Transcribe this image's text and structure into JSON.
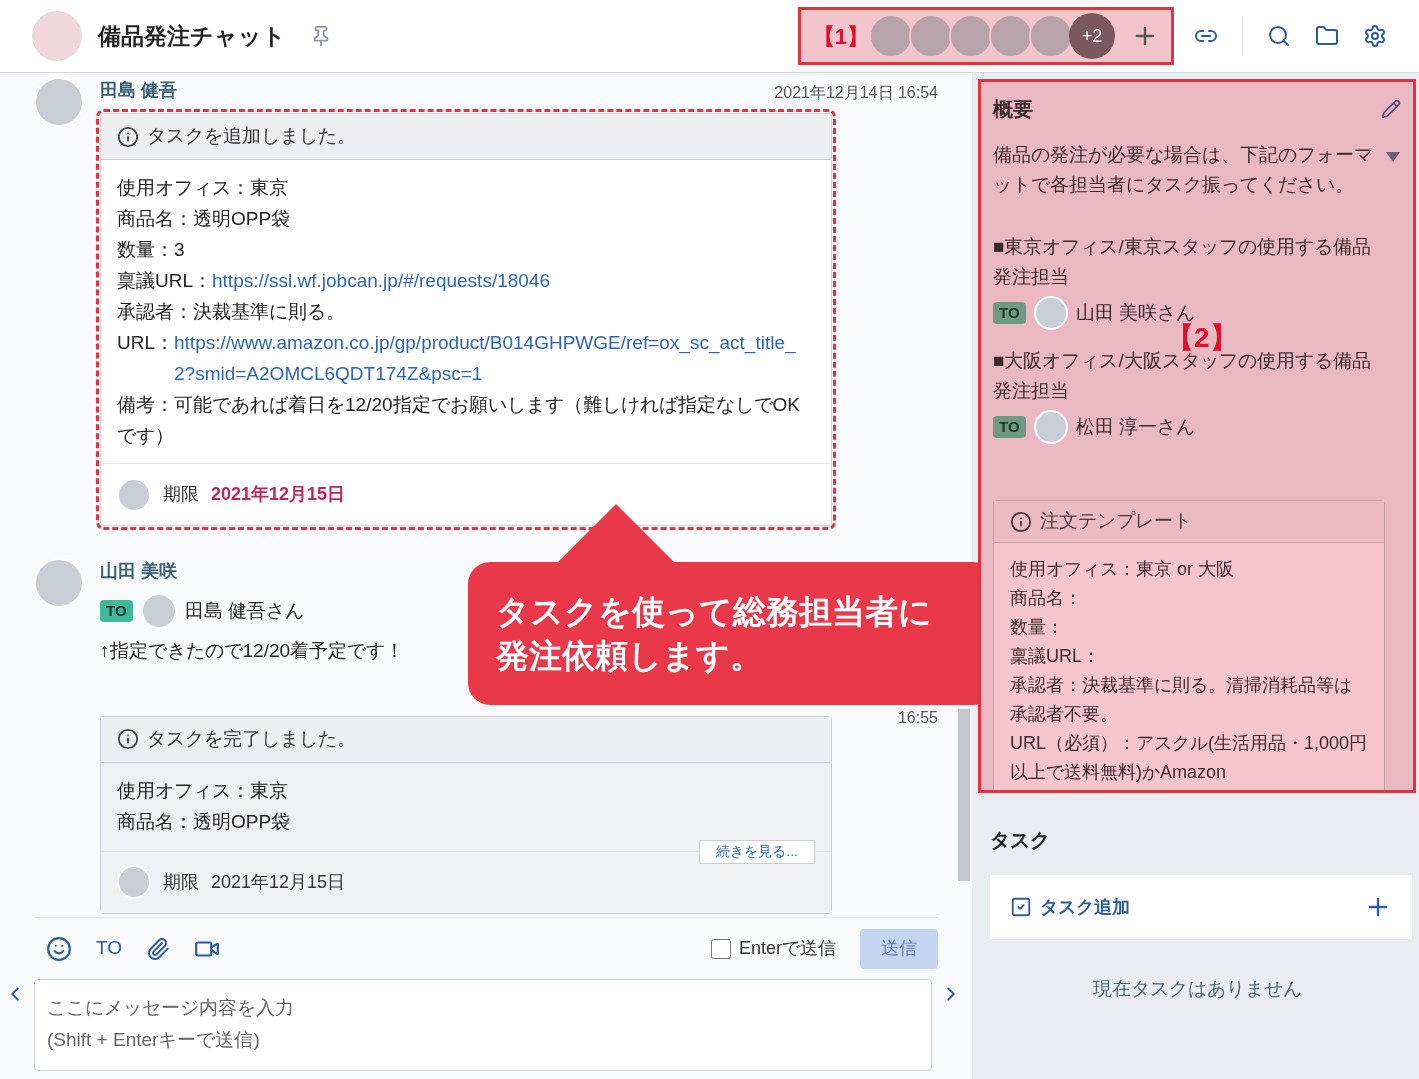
{
  "header": {
    "title": "備品発注チャット",
    "marker": "【1】",
    "members_more": "+2"
  },
  "messages": [
    {
      "sender": "田島 健吾",
      "time": "2021年12月14日 16:54",
      "task": {
        "header": "タスクを追加しました。",
        "annotated": true,
        "lines": [
          {
            "text": "使用オフィス：東京"
          },
          {
            "text": "商品名：透明OPP袋"
          },
          {
            "text": "数量：3"
          },
          {
            "text": "稟議URL：",
            "link": "https://ssl.wf.jobcan.jp/#/requests/18046"
          },
          {
            "text": "承認者：決裁基準に則る。"
          },
          {
            "text": "URL：",
            "link": "https://www.amazon.co.jp/gp/product/B014GHPWGE/ref=ox_sc_act_title_2?smid=A2OMCL6QDT174Z&psc=1"
          },
          {
            "text": "備考：可能であれば着日を12/20指定でお願いします（難しければ指定なしでOKです）"
          }
        ],
        "deadline_label": "期限",
        "deadline": "2021年12月15日",
        "highlighted": true
      }
    },
    {
      "sender": "山田 美咲",
      "to_badge": "TO",
      "to_name": "田島 健吾さん",
      "body": "↑指定できたので12/20着予定です！"
    },
    {
      "time": "16:55",
      "task": {
        "header": "タスクを完了しました。",
        "annotated": false,
        "lines": [
          {
            "text": "使用オフィス：東京"
          },
          {
            "text": "商品名：透明OPP袋"
          }
        ],
        "more": "続きを見る...",
        "deadline_label": "期限",
        "deadline": "2021年12月15日",
        "highlighted": false
      }
    }
  ],
  "callout_lines": [
    "タスクを使って総務担当者に",
    "発注依頼します。"
  ],
  "composer": {
    "to": "TO",
    "enter_send": {
      "label": "Enterで送信",
      "checked": false
    },
    "send": {
      "label": "送信",
      "disabled": true
    },
    "placeholder": "ここにメッセージ内容を入力\n(Shift + Enterキーで送信)"
  },
  "overview": {
    "title": "概要",
    "marker": "【2】",
    "intro": "備品の発注が必要な場合は、下記のフォーマットで各担当者にタスク振ってください。",
    "assignments": [
      {
        "heading": "■東京オフィス/東京スタッフの使用する備品発注担当",
        "badge": "TO",
        "name": "山田 美咲さん"
      },
      {
        "heading": "■大阪オフィス/大阪スタッフの使用する備品発注担当",
        "badge": "TO",
        "name": "松田 淳一さん"
      }
    ],
    "template": {
      "title": "注文テンプレート",
      "lines": [
        "使用オフィス：東京 or 大阪",
        "商品名：",
        "数量：",
        "稟議URL：",
        "承認者：決裁基準に則る。清掃消耗品等は承認者不要。",
        "URL（必須）：アスクル(生活用品・1,000円以上で送料無料)かAmazon"
      ]
    }
  },
  "tasks": {
    "title": "タスク",
    "add": "タスク追加",
    "empty": "現在タスクはありません"
  }
}
